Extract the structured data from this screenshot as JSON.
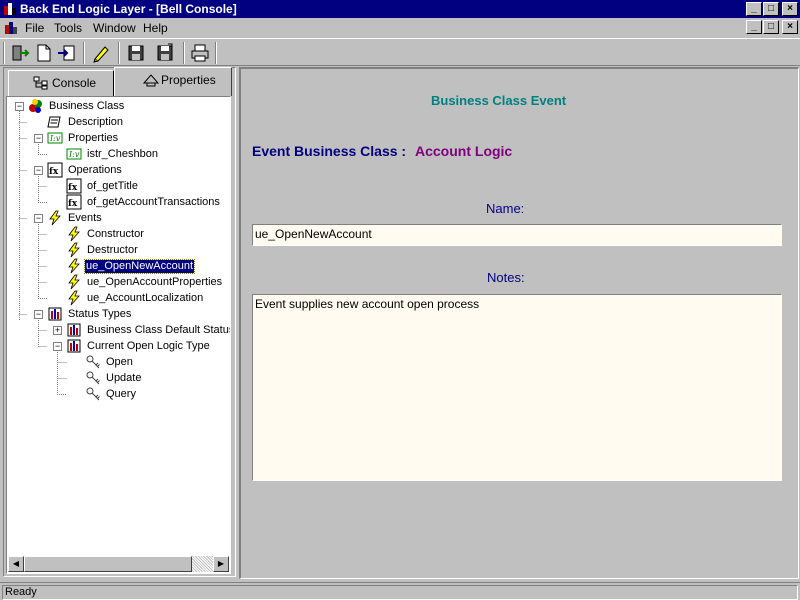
{
  "window": {
    "title": "Back End Logic Layer - [Bell Console]",
    "minimize_glyph": "_",
    "maximize_glyph": "□",
    "close_glyph": "×"
  },
  "menu": {
    "file": "File",
    "tools": "Tools",
    "window": "Window",
    "help": "Help"
  },
  "toolbar": {
    "buttons": [
      "exit-icon",
      "new-icon",
      "import-icon",
      "edit-icon",
      "save-icon",
      "save-as-icon",
      "print-icon"
    ]
  },
  "left_panel": {
    "tabs": {
      "console": "Console",
      "properties": "Properties"
    },
    "active_tab": "Properties",
    "tree": {
      "root": "Business Class",
      "description": "Description",
      "properties": "Properties",
      "property_items": [
        "istr_Cheshbon"
      ],
      "operations": "Operations",
      "operation_items": [
        "of_getTitle",
        "of_getAccountTransactions"
      ],
      "events": "Events",
      "event_items": [
        "Constructor",
        "Destructor",
        "ue_OpenNewAccount",
        "ue_OpenAccountProperties",
        "ue_AccountLocalization"
      ],
      "selected_event": "ue_OpenNewAccount",
      "status_types": "Status Types",
      "status_default": "Business Class Default Status",
      "status_current": "Current Open Logic Type",
      "logic_types": [
        "Open",
        "Update",
        "Query"
      ]
    }
  },
  "form": {
    "heading": "Business Class Event",
    "event_class_label": "Event Business Class :",
    "event_class_value": "Account Logic",
    "name_label": "Name:",
    "name_value": "ue_OpenNewAccount",
    "notes_label": "Notes:",
    "notes_value": "Event supplies new account open process"
  },
  "status": {
    "text": "Ready"
  },
  "colors": {
    "titlebar": "#000080",
    "heading": "#008080",
    "label": "#000080",
    "value": "#800080",
    "field_background": "#fffbf0",
    "chrome": "#c0c0c0"
  }
}
